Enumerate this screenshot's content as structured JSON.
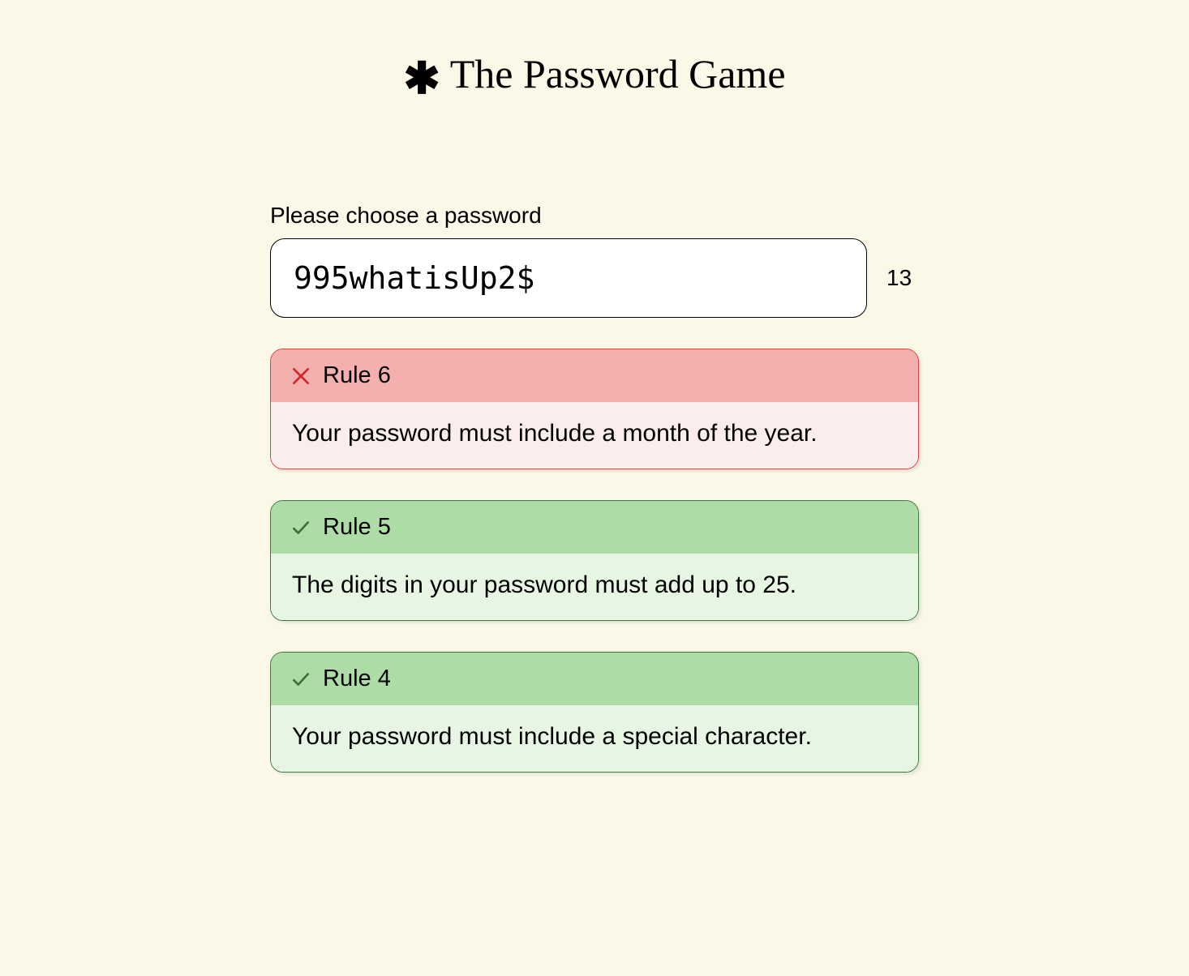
{
  "title": "The Password Game",
  "prompt": "Please choose a password",
  "password_value": "995whatisUp2$",
  "char_count": "13",
  "rules": [
    {
      "status": "fail",
      "label": "Rule 6",
      "description": "Your password must include a month of the year."
    },
    {
      "status": "pass",
      "label": "Rule 5",
      "description": "The digits in your password must add up to 25."
    },
    {
      "status": "pass",
      "label": "Rule 4",
      "description": "Your password must include a special character."
    }
  ],
  "colors": {
    "background": "#fbf8e8",
    "fail_border": "#ea3b3b",
    "fail_header": "#f4b0ae",
    "fail_body": "#fceded",
    "pass_border": "#3a7a3a",
    "pass_header": "#aedca7",
    "pass_body": "#e6f6e2"
  }
}
